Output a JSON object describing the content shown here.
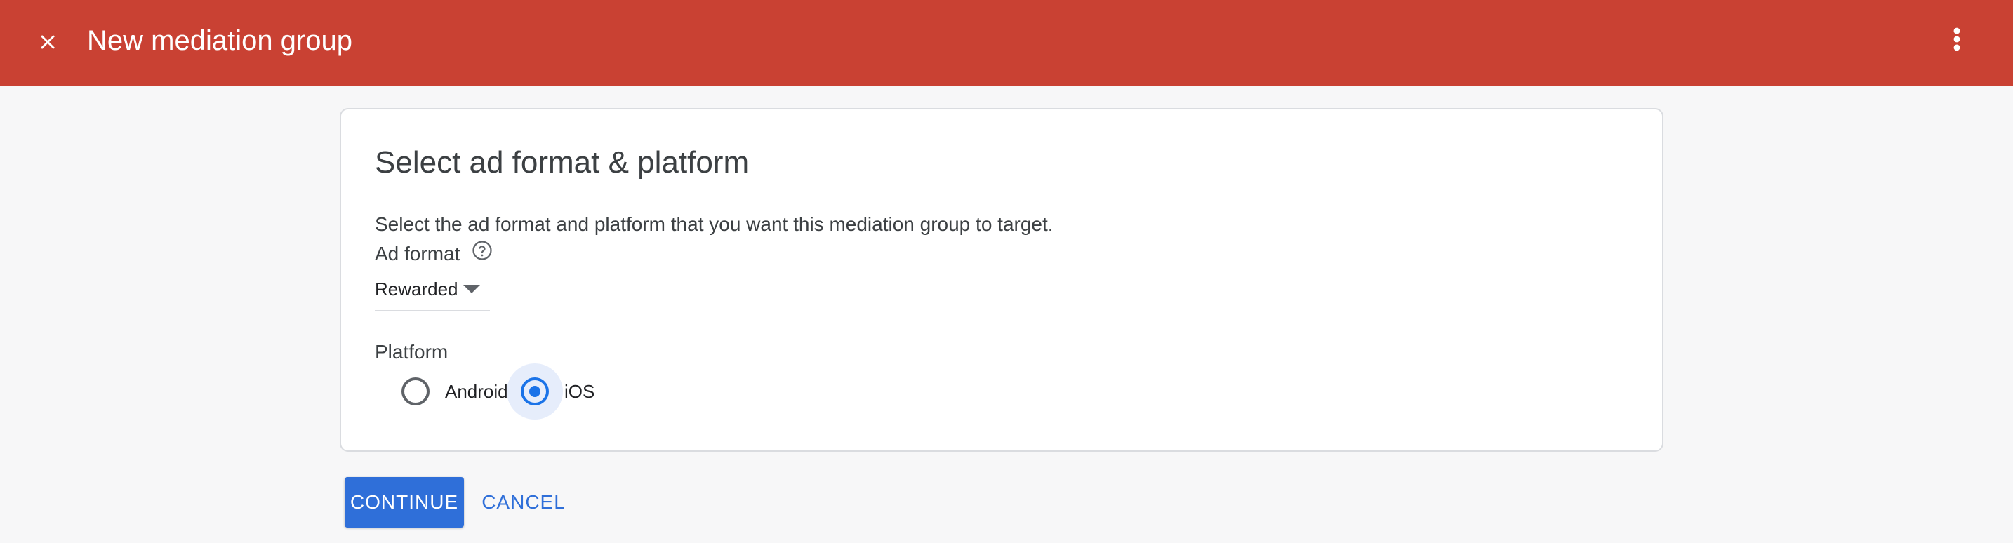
{
  "header": {
    "title": "New mediation group",
    "close_icon": "close-icon",
    "more_icon": "more-vert-icon",
    "color": "#c94133"
  },
  "card": {
    "title": "Select ad format & platform",
    "description": "Select the ad format and platform that you want this mediation group to target.",
    "ad_format": {
      "label": "Ad format",
      "help_icon": "help-outline-icon",
      "selected": "Rewarded",
      "caret_icon": "arrow-drop-down-icon"
    },
    "platform": {
      "label": "Platform",
      "options": [
        {
          "label": "Android",
          "checked": false
        },
        {
          "label": "iOS",
          "checked": true
        }
      ]
    }
  },
  "actions": {
    "continue_label": "CONTINUE",
    "cancel_label": "CANCEL",
    "accent": "#2f6fd9"
  }
}
